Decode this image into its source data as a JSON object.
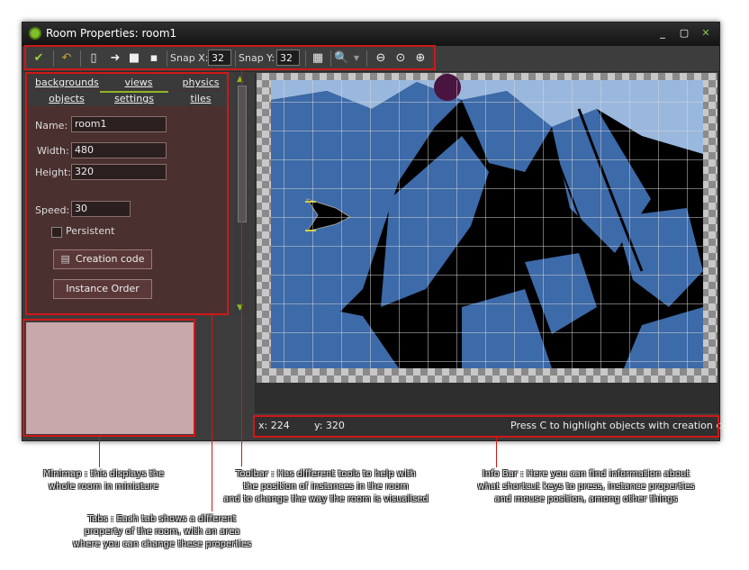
{
  "window": {
    "title": "Room Properties: room1",
    "controls": [
      "_",
      "▢",
      "✕"
    ]
  },
  "toolbar": {
    "snap_x_label": "Snap X:",
    "snap_x_value": "32",
    "snap_y_label": "Snap Y:",
    "snap_y_value": "32",
    "icons": [
      "confirm-check-icon",
      "undo-icon",
      "new-file-icon",
      "arrow-right-icon",
      "lock-icon",
      "unlock-icon",
      "grid-icon",
      "zoom-dropdown-icon",
      "zoom-out-icon",
      "zoom-reset-icon",
      "zoom-in-icon"
    ]
  },
  "tabs": {
    "row1": [
      "backgrounds",
      "views",
      "physics"
    ],
    "row2": [
      "objects",
      "settings",
      "tiles"
    ],
    "active": "settings"
  },
  "settings": {
    "name_label": "Name:",
    "name_value": "room1",
    "width_label": "Width:",
    "width_value": "480",
    "height_label": "Height:",
    "height_value": "320",
    "speed_label": "Speed:",
    "speed_value": "30",
    "persistent_label": "Persistent",
    "creation_code_button": "Creation code",
    "instance_order_button": "Instance Order"
  },
  "infobar": {
    "x": "x: 224",
    "y": "y: 320",
    "hint": "Press C to highlight objects with creation cc"
  },
  "annotations": {
    "minimap": "Minimap : this displays the\nwhole room in miniature",
    "toolbar": "Toolbar : Has different tools to help with\nthe position of instances in the room\nand to change the way the room is visualised",
    "infobar": "Info Bar : Here you can find information about\nwhat shortcut keys to press, instance properties\nand mouse position, among other things",
    "tabs": "Tabs : Each tab shows a different\nproperty of the room, with an area\nwhere you can  change these properties"
  },
  "colors": {
    "accent_green": "#8bb72a",
    "room_blue": "#3d6aa8",
    "annotation_red": "#d01818"
  }
}
